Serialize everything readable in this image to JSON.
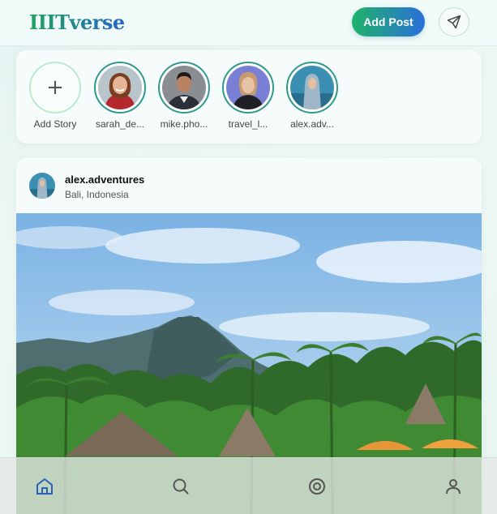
{
  "header": {
    "logo": "IIITverse",
    "add_post_label": "Add Post"
  },
  "stories": [
    {
      "label": "Add Story",
      "type": "add"
    },
    {
      "label": "sarah_de..."
    },
    {
      "label": "mike.pho..."
    },
    {
      "label": "travel_l..."
    },
    {
      "label": "alex.adv..."
    }
  ],
  "post": {
    "username": "alex.adventures",
    "location": "Bali, Indonesia"
  },
  "bottom_nav": {
    "items": [
      "home-icon",
      "search-icon",
      "explore-icon",
      "profile-icon"
    ],
    "active": "home-icon"
  },
  "colors": {
    "brand_green": "#1fa35a",
    "brand_blue": "#2464c8",
    "active_nav": "#2c5fb8"
  }
}
